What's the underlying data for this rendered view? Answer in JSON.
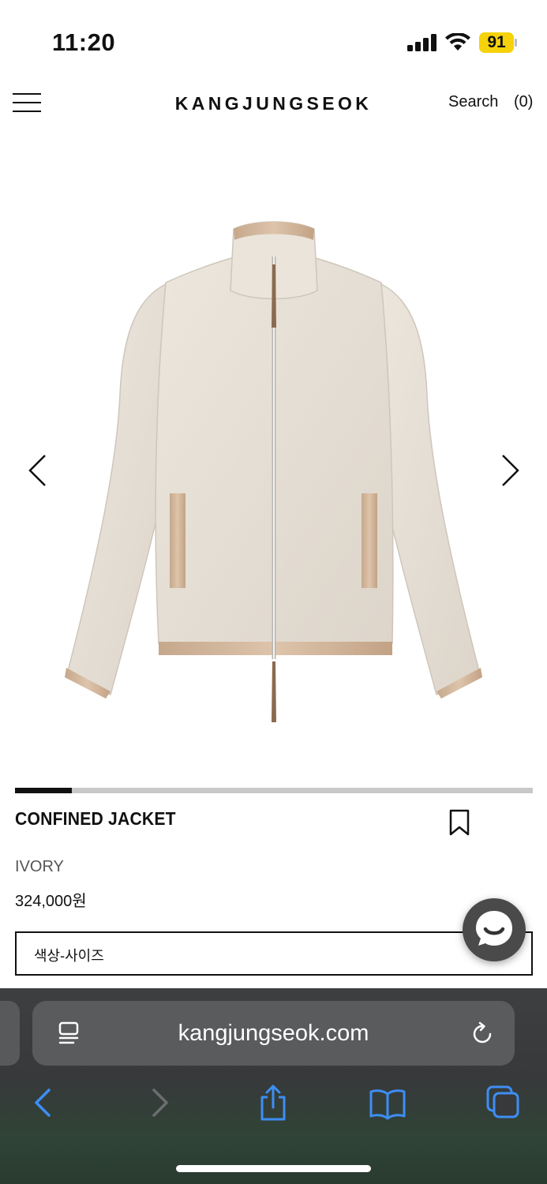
{
  "status_bar": {
    "time": "11:20",
    "battery_level": "91",
    "battery_color": "#f5d20a"
  },
  "header": {
    "brand": "KANGJUNGSEOK",
    "search_label": "Search",
    "cart_count": "(0)"
  },
  "product": {
    "name": "CONFINED JACKET",
    "color": "IVORY",
    "price": "324,000원",
    "option_placeholder": "색상-사이즈",
    "image_progress": 0.11
  },
  "browser": {
    "url": "kangjungseok.com"
  },
  "icons": [
    "menu-icon",
    "chevron-left-icon",
    "chevron-right-icon",
    "bookmark-icon",
    "chat-icon",
    "reader-icon",
    "reload-icon",
    "back-icon",
    "forward-icon",
    "share-icon",
    "bookmarks-icon",
    "tabs-icon"
  ]
}
